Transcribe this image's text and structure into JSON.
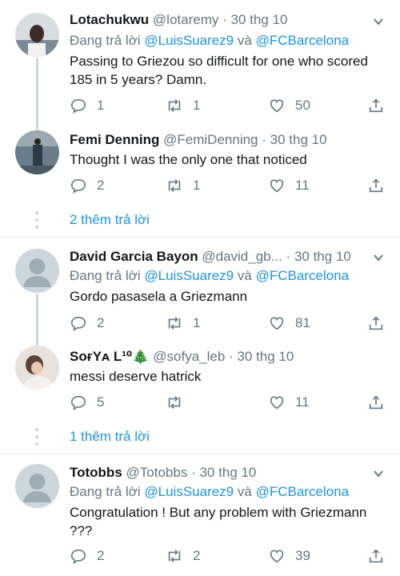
{
  "tweets": [
    {
      "name": "Lotachukwu",
      "handle": "@lotaremy",
      "sep": "·",
      "date": "30 thg 10",
      "reply_prefix": "Đang trả lời",
      "mention1": "@LuisSuarez9",
      "reply_and": "và",
      "mention2": "@FCBarcelona",
      "text": "Passing to Griezou so difficult for one who scored 185 in 5 years? Damn.",
      "replies": "1",
      "retweets": "1",
      "likes": "50"
    },
    {
      "name": "Femi Denning",
      "handle": "@FemiDenning",
      "sep": "·",
      "date": "30 thg 10",
      "text": "Thought I was the only one that noticed",
      "replies": "2",
      "retweets": "1",
      "likes": "11"
    },
    {
      "name": "David Garcia Bayon",
      "handle": "@david_gb...",
      "sep": "·",
      "date": "30 thg 10",
      "reply_prefix": "Đang trả lời",
      "mention1": "@LuisSuarez9",
      "reply_and": "và",
      "mention2": "@FCBarcelona",
      "text": "Gordo pasasela a Griezmann",
      "replies": "2",
      "retweets": "1",
      "likes": "81"
    },
    {
      "name": "SᴏғYᴀ L¹⁰🎄",
      "handle": "@sofya_leb",
      "sep": "·",
      "date": "30 thg 10",
      "text": "messi deserve hatrick",
      "replies": "5",
      "retweets": "",
      "likes": "11"
    },
    {
      "name": "Totobbs",
      "handle": "@Totobbs",
      "sep": "·",
      "date": "30 thg 10",
      "reply_prefix": "Đang trả lời",
      "mention1": "@LuisSuarez9",
      "reply_and": "và",
      "mention2": "@FCBarcelona",
      "text": "Congratulation ! But any problem with Griezmann ???",
      "replies": "2",
      "retweets": "2",
      "likes": "39"
    }
  ],
  "more_replies": [
    {
      "label": "2 thêm trả lời"
    },
    {
      "label": "1 thêm trả lời"
    }
  ],
  "colors": {
    "accent": "#1b95e0",
    "secondary_text": "#657786",
    "divider": "#e6ecf0"
  }
}
